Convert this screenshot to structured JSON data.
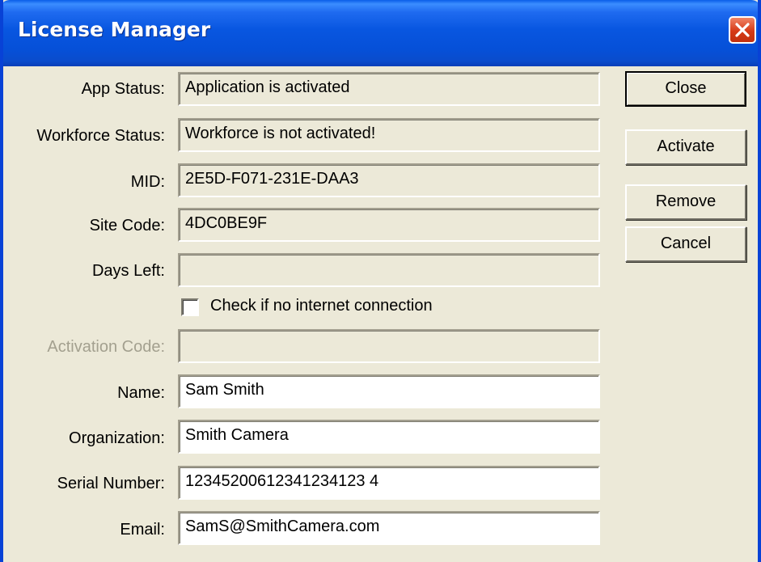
{
  "window": {
    "title": "License Manager"
  },
  "fields": {
    "app_status": {
      "label": "App Status:",
      "value": "Application is activated"
    },
    "workforce_status": {
      "label": "Workforce Status:",
      "value": "Workforce is not activated!"
    },
    "mid": {
      "label": "MID:",
      "value": "2E5D-F071-231E-DAA3"
    },
    "site_code": {
      "label": "Site Code:",
      "value": "4DC0BE9F"
    },
    "days_left": {
      "label": "Days Left:",
      "value": ""
    },
    "activation_code": {
      "label": "Activation Code:",
      "value": ""
    },
    "name": {
      "label": "Name:",
      "value": "Sam Smith"
    },
    "organization": {
      "label": "Organization:",
      "value": "Smith Camera"
    },
    "serial_number": {
      "label": "Serial Number:",
      "value": "12345200612341234123 4"
    },
    "email": {
      "label": "Email:",
      "value": "SamS@SmithCamera.com"
    }
  },
  "checkbox": {
    "label": "Check if no internet connection",
    "checked": false
  },
  "buttons": {
    "close": "Close",
    "activate": "Activate",
    "remove": "Remove",
    "cancel": "Cancel"
  },
  "colors": {
    "titlebar": "#0856e0",
    "dialog_bg": "#ece9d8",
    "close_button": "#d63a17",
    "disabled_text": "#a3a08f"
  }
}
